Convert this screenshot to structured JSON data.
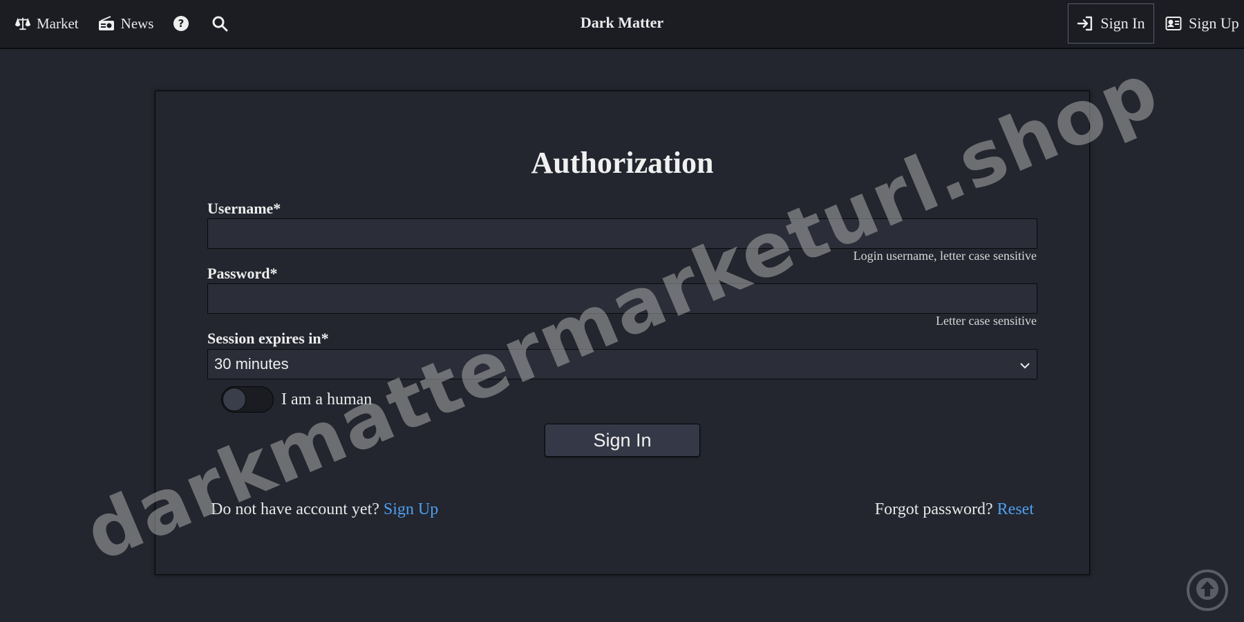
{
  "header": {
    "brand": "Dark Matter",
    "nav": {
      "market_label": "Market",
      "news_label": "News"
    },
    "signin_label": "Sign In",
    "signup_label": "Sign Up"
  },
  "form": {
    "title": "Authorization",
    "username": {
      "label": "Username*",
      "value": "",
      "hint": "Login username, letter case sensitive"
    },
    "password": {
      "label": "Password*",
      "value": "",
      "hint": "Letter case sensitive"
    },
    "session": {
      "label": "Session expires in*",
      "selected": "30 minutes"
    },
    "human_toggle": {
      "label": "I am a human",
      "checked": false
    },
    "submit_label": "Sign In"
  },
  "footer": {
    "no_account_text": "Do not have account yet?",
    "signup_link": "Sign Up",
    "forgot_text": "Forgot password?",
    "reset_link": "Reset"
  },
  "watermark": "darkmattermarketurl.shop",
  "icons": {
    "market": "scale-icon",
    "news": "radio-icon",
    "help": "question-circle-icon",
    "search": "search-icon",
    "signin": "sign-in-icon",
    "signup": "id-card-icon",
    "scroll_top": "arrow-up-circle-icon",
    "dropdown": "chevron-down-icon"
  },
  "colors": {
    "background": "#23262f",
    "header": "#1b1d23",
    "link": "#4f9ff0"
  }
}
